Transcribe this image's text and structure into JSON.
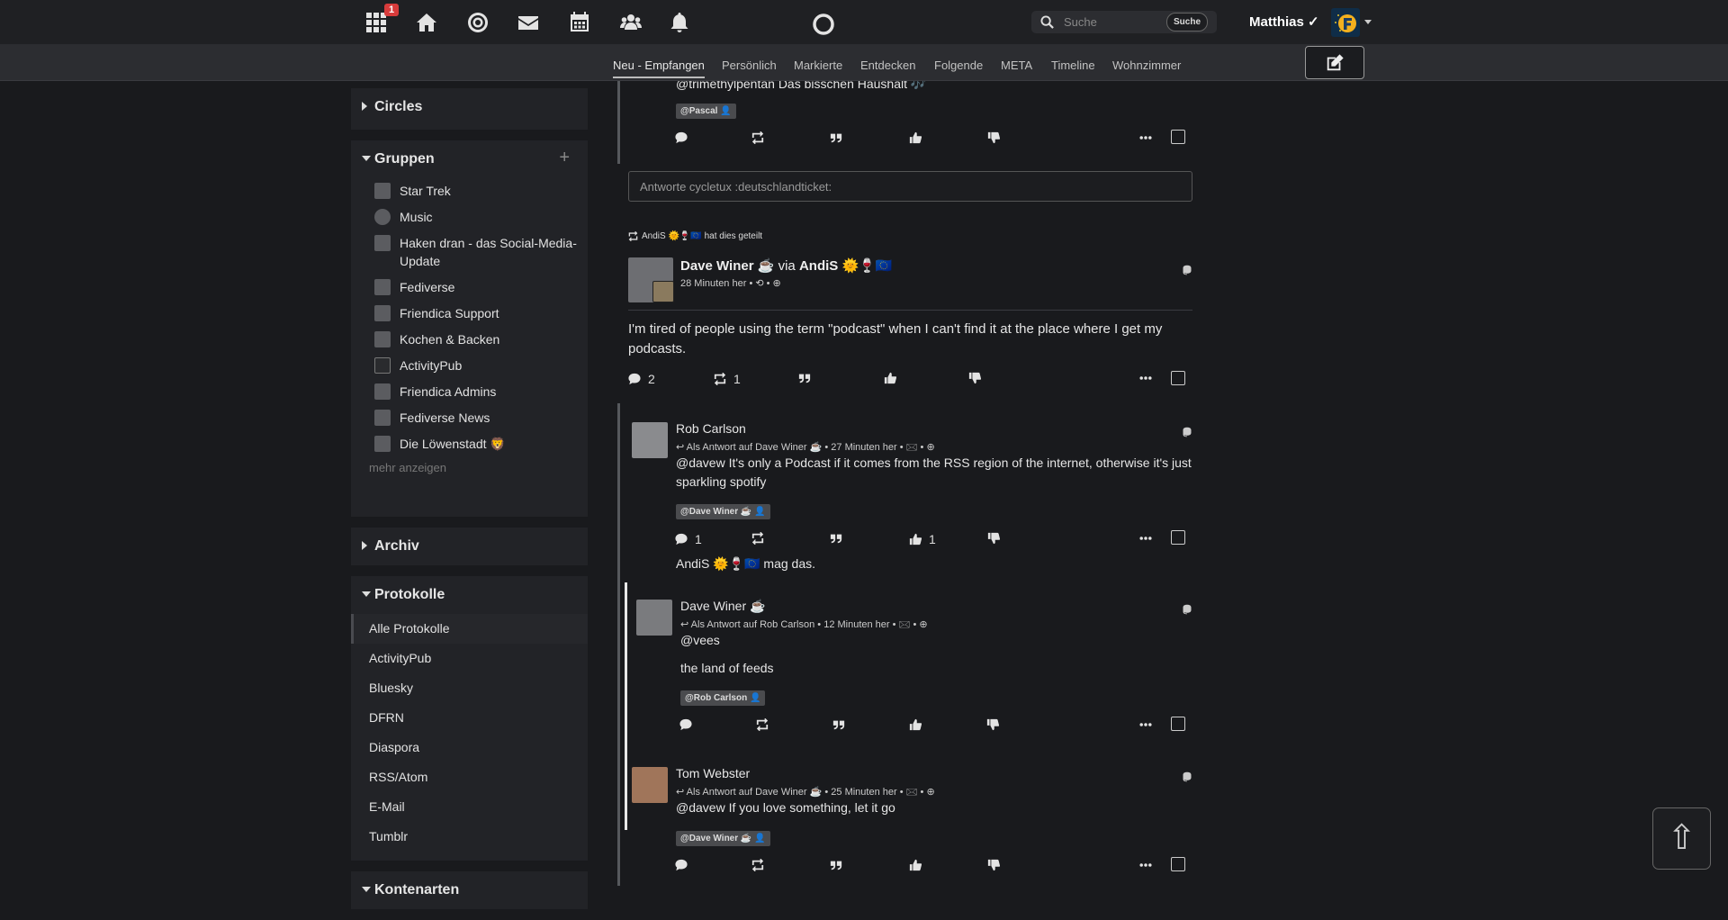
{
  "topbar": {
    "notification_count": "1",
    "search_placeholder": "Suche",
    "search_button": "Suche",
    "user_name": "Matthias ✓"
  },
  "tabs": [
    {
      "label": "Neu - Empfangen",
      "active": true
    },
    {
      "label": "Persönlich"
    },
    {
      "label": "Markierte"
    },
    {
      "label": "Entdecken"
    },
    {
      "label": "Folgende"
    },
    {
      "label": "META"
    },
    {
      "label": "Timeline"
    },
    {
      "label": "Wohnzimmer"
    }
  ],
  "sidebar": {
    "circles_title": "Circles",
    "groups_title": "Gruppen",
    "groups": [
      {
        "label": "Star Trek"
      },
      {
        "label": "Music"
      },
      {
        "label": "Haken dran - das Social-Media-Update"
      },
      {
        "label": "Fediverse"
      },
      {
        "label": "Friendica Support"
      },
      {
        "label": "Kochen & Backen"
      },
      {
        "label": "ActivityPub"
      },
      {
        "label": "Friendica Admins"
      },
      {
        "label": "Fediverse News"
      },
      {
        "label": "Die Löwenstadt 🦁"
      }
    ],
    "more_label": "mehr anzeigen",
    "archive_title": "Archiv",
    "protocols_title": "Protokolle",
    "protocols": [
      {
        "label": "Alle Protokolle",
        "active": true
      },
      {
        "label": "ActivityPub"
      },
      {
        "label": "Bluesky"
      },
      {
        "label": "DFRN"
      },
      {
        "label": "Diaspora"
      },
      {
        "label": "RSS/Atom"
      },
      {
        "label": "E-Mail"
      },
      {
        "label": "Tumblr"
      }
    ],
    "account_types_title": "Kontenarten"
  },
  "feed": {
    "top_post": {
      "text_partial": "@trimethylpentan Das bisschen Haushalt 🎶",
      "mention": "@Pascal"
    },
    "reply_placeholder": "Antworte cycletux :deutschlandticket:",
    "main_post": {
      "shared_by": "AndiS 🌞🍷🇪🇺 hat dies geteilt",
      "author": "Dave Winer ☕",
      "via_label": "via",
      "via_author": "AndiS 🌞🍷🇪🇺",
      "time": "28 Minuten her",
      "text": "I'm tired of people using the term \"podcast\" when I can't find it at the place where I get my podcasts.",
      "comment_count": "2",
      "reshare_count": "1"
    },
    "comments": [
      {
        "author": "Rob Carlson",
        "meta": "Als Antwort auf Dave Winer ☕ • 27 Minuten her •",
        "text": "@davew It's only a Podcast if it comes from the RSS region of the internet, otherwise it's just sparkling spotify",
        "mention": "@Dave Winer ☕",
        "comment_count": "1",
        "like_count": "1",
        "liked_by": "AndiS 🌞🍷🇪🇺 mag das."
      },
      {
        "author": "Dave Winer ☕",
        "meta": "Als Antwort auf Rob Carlson • 12 Minuten her •",
        "text1": "@vees",
        "text2": "the land of feeds",
        "mention": "@Rob Carlson"
      },
      {
        "author": "Tom Webster",
        "meta": "Als Antwort auf Dave Winer ☕ • 25 Minuten her •",
        "text": "@davew If you love something, let it go",
        "mention": "@Dave Winer ☕"
      }
    ]
  },
  "scroll_top_glyph": "⇧"
}
